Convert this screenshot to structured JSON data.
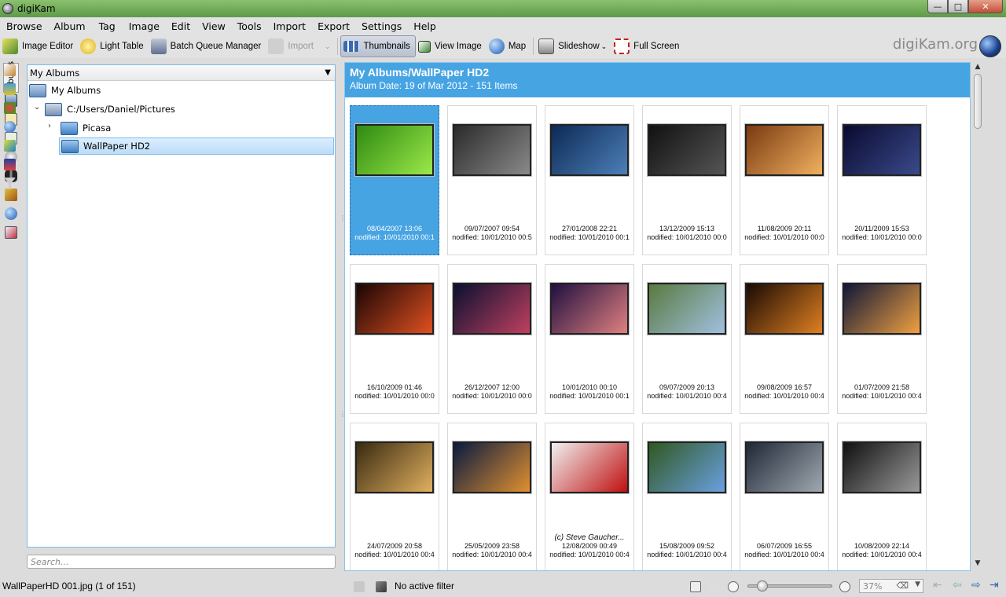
{
  "window": {
    "title": "digiKam",
    "min": "—",
    "max": "□",
    "close": "✕"
  },
  "menu": [
    "Browse",
    "Album",
    "Tag",
    "Image",
    "Edit",
    "View",
    "Tools",
    "Import",
    "Export",
    "Settings",
    "Help"
  ],
  "toolbar": {
    "image_editor": "Image Editor",
    "light_table": "Light Table",
    "batch_queue": "Batch Queue Manager",
    "import": "Import",
    "thumbnails": "Thumbnails",
    "view_image": "View Image",
    "map": "Map",
    "slideshow": "Slideshow",
    "full_screen": "Full Screen",
    "logo": "digiKam.org"
  },
  "left_tab": "Albums",
  "sidebar": {
    "header": "My Albums",
    "tree": [
      {
        "label": "My Albums"
      },
      {
        "label": "C:/Users/Daniel/Pictures"
      },
      {
        "label": "Picasa"
      },
      {
        "label": "WallPaper HD2"
      }
    ],
    "search_placeholder": "Search..."
  },
  "main": {
    "title": "My Albums/WallPaper HD2",
    "subtitle": "Album Date: 19 of Mar 2012 - 151 Items",
    "items": [
      {
        "date": "08/04/2007 13:06",
        "mod": "nodified: 10/01/2010 00:1",
        "comment": ""
      },
      {
        "date": "09/07/2007 09:54",
        "mod": "nodified: 10/01/2010 00:5",
        "comment": ""
      },
      {
        "date": "27/01/2008 22:21",
        "mod": "nodified: 10/01/2010 00:1",
        "comment": ""
      },
      {
        "date": "13/12/2009 15:13",
        "mod": "nodified: 10/01/2010 00:0",
        "comment": ""
      },
      {
        "date": "11/08/2009 20:11",
        "mod": "nodified: 10/01/2010 00:0",
        "comment": ""
      },
      {
        "date": "20/11/2009 15:53",
        "mod": "nodified: 10/01/2010 00:0",
        "comment": ""
      },
      {
        "date": "16/10/2009 01:46",
        "mod": "nodified: 10/01/2010 00:0",
        "comment": ""
      },
      {
        "date": "26/12/2007 12:00",
        "mod": "nodified: 10/01/2010 00:0",
        "comment": ""
      },
      {
        "date": "10/01/2010 00:10",
        "mod": "nodified: 10/01/2010 00:1",
        "comment": ""
      },
      {
        "date": "09/07/2009 20:13",
        "mod": "nodified: 10/01/2010 00:4",
        "comment": ""
      },
      {
        "date": "09/08/2009 16:57",
        "mod": "nodified: 10/01/2010 00:4",
        "comment": ""
      },
      {
        "date": "01/07/2009 21:58",
        "mod": "nodified: 10/01/2010 00:4",
        "comment": ""
      },
      {
        "date": "24/07/2009 20:58",
        "mod": "nodified: 10/01/2010 00:4",
        "comment": ""
      },
      {
        "date": "25/05/2009 23:58",
        "mod": "nodified: 10/01/2010 00:4",
        "comment": ""
      },
      {
        "date": "12/08/2009 00:49",
        "mod": "nodified: 10/01/2010 00:4",
        "comment": "(c) Steve Gaucher..."
      },
      {
        "date": "15/08/2009 09:52",
        "mod": "nodified: 10/01/2010 00:4",
        "comment": ""
      },
      {
        "date": "06/07/2009 16:55",
        "mod": "nodified: 10/01/2010 00:4",
        "comment": ""
      },
      {
        "date": "10/08/2009 22:14",
        "mod": "nodified: 10/01/2010 00:4",
        "comment": ""
      }
    ]
  },
  "status": {
    "left": "WallPaperHD 001.jpg (1 of 151)",
    "filter": "No active filter",
    "zoom": "37%",
    "zoom_slider": 0.12
  },
  "thumb_colors": [
    [
      "#2e8a10",
      "#9be84a"
    ],
    [
      "#2a2a2a",
      "#8a8a8a"
    ],
    [
      "#0c2a55",
      "#4d7fb8"
    ],
    [
      "#111",
      "#555"
    ],
    [
      "#7a3a10",
      "#f0b060"
    ],
    [
      "#0a0a30",
      "#3a4a8a"
    ],
    [
      "#1a0505",
      "#e05020"
    ],
    [
      "#0a1030",
      "#c04060"
    ],
    [
      "#201040",
      "#e08080"
    ],
    [
      "#5a7a40",
      "#a0c0e0"
    ],
    [
      "#1a0a05",
      "#e08020"
    ],
    [
      "#101838",
      "#f0a040"
    ],
    [
      "#3a2a10",
      "#e0b060"
    ],
    [
      "#0a1a40",
      "#e09030"
    ],
    [
      "#f0f0f0",
      "#c01010"
    ],
    [
      "#305820",
      "#6aa0e0"
    ],
    [
      "#202838",
      "#a0a8b0"
    ],
    [
      "#111",
      "#999"
    ]
  ]
}
